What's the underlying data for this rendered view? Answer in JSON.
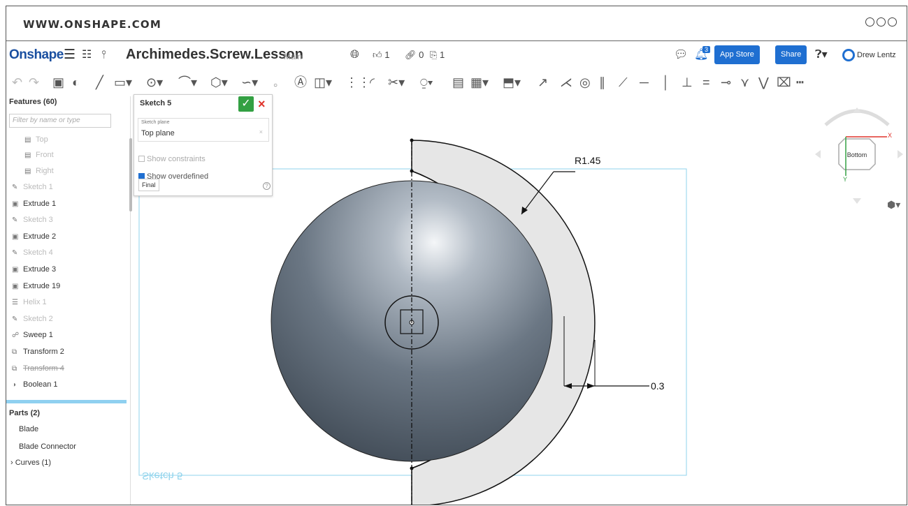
{
  "browser": {
    "url": "WWW.ONSHAPE.COM"
  },
  "header": {
    "logo": "Onshape",
    "doc_title": "Archimedes.Screw.Lesson",
    "branch": "Main",
    "likes": "1",
    "links": "0",
    "copies": "1",
    "app_store_label": "App Store",
    "share_label": "Share",
    "user_name": "Drew Lentz",
    "notification_count": "3"
  },
  "features": {
    "header": "Features (60)",
    "filter_placeholder": "Filter by name or type",
    "items": [
      {
        "label": "Top",
        "state": "dim",
        "icon": "plane-icon"
      },
      {
        "label": "Front",
        "state": "dim",
        "icon": "plane-icon"
      },
      {
        "label": "Right",
        "state": "dim",
        "icon": "plane-icon"
      },
      {
        "label": "Sketch 1",
        "state": "dim",
        "icon": "sketch-icon"
      },
      {
        "label": "Extrude 1",
        "state": "normal",
        "icon": "extrude-icon"
      },
      {
        "label": "Sketch 3",
        "state": "dim",
        "icon": "sketch-icon"
      },
      {
        "label": "Extrude 2",
        "state": "normal",
        "icon": "extrude-icon"
      },
      {
        "label": "Sketch 4",
        "state": "dim",
        "icon": "sketch-icon"
      },
      {
        "label": "Extrude 3",
        "state": "normal",
        "icon": "extrude-icon"
      },
      {
        "label": "Extrude 19",
        "state": "normal",
        "icon": "extrude-icon"
      },
      {
        "label": "Helix 1",
        "state": "dim",
        "icon": "helix-icon"
      },
      {
        "label": "Sketch 2",
        "state": "dim",
        "icon": "sketch-icon"
      },
      {
        "label": "Sweep 1",
        "state": "normal",
        "icon": "sweep-icon"
      },
      {
        "label": "Transform 2",
        "state": "normal",
        "icon": "transform-icon"
      },
      {
        "label": "Transform 4",
        "state": "strike",
        "icon": "transform-icon"
      },
      {
        "label": "Boolean 1",
        "state": "normal",
        "icon": "boolean-icon"
      }
    ]
  },
  "parts": {
    "header": "Parts (2)",
    "items": [
      "Blade",
      "Blade Connector"
    ],
    "curves": "Curves (1)"
  },
  "sketch_dialog": {
    "title": "Sketch 5",
    "plane_label": "Sketch plane",
    "plane_value": "Top plane",
    "show_constraints": "Show constraints",
    "show_constraints_checked": false,
    "show_overdefined": "Show overdefined",
    "show_overdefined_checked": true,
    "final_label": "Final"
  },
  "canvas": {
    "radius_dimension": "R1.45",
    "offset_dimension": "0.3",
    "sketch_label": "Sketch 5"
  },
  "view_cube": {
    "face": "Bottom",
    "x_axis": "X",
    "y_axis": "Y"
  },
  "colors": {
    "brand": "#1a4fa0",
    "accent": "#1f6fd1",
    "confirm": "#33a043",
    "cancel": "#e0332b",
    "sketch_line": "#7fd0ec"
  }
}
